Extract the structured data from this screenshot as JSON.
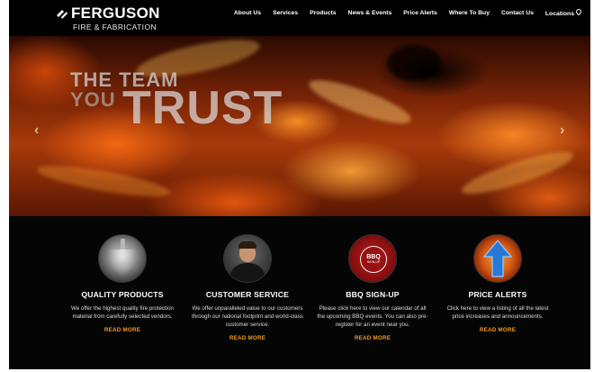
{
  "brand": {
    "name": "FERGUSON",
    "tagline": "FIRE & FABRICATION"
  },
  "nav": {
    "items": [
      {
        "label": "About Us"
      },
      {
        "label": "Services"
      },
      {
        "label": "Products"
      },
      {
        "label": "News & Events"
      },
      {
        "label": "Price Alerts"
      },
      {
        "label": "Where To Buy"
      },
      {
        "label": "Contact Us"
      },
      {
        "label": "Locations"
      }
    ]
  },
  "hero": {
    "line1": "THE TEAM",
    "line2": "YOU",
    "line3": "TRUST",
    "prev_glyph": "‹",
    "next_glyph": "›"
  },
  "features": [
    {
      "title": "QUALITY PRODUCTS",
      "description": "We offer the highest quality fire protection material from carefully selected vendors.",
      "link": "READ MORE",
      "icon": "sprinkler-icon"
    },
    {
      "title": "CUSTOMER SERVICE",
      "description": "We offer unparalleled value to our customers through our national footprint and world-class customer service.",
      "link": "READ MORE",
      "icon": "customer-photo"
    },
    {
      "title": "BBQ SIGN-UP",
      "description": "Please click here to view our calendar of all the upcoming BBQ events. You can also pre-register for an event near you.",
      "link": "READ MORE",
      "icon": "bbq-badge",
      "badge_text": "BBQ",
      "badge_sub": "SIGN-UP"
    },
    {
      "title": "PRICE ALERTS",
      "description": "Click here to view a listing of all the latest price increases and announcements.",
      "link": "READ MORE",
      "icon": "arrow-up-icon"
    }
  ],
  "colors": {
    "accent": "#f19a1f",
    "background": "#050505",
    "header": "#000000"
  }
}
